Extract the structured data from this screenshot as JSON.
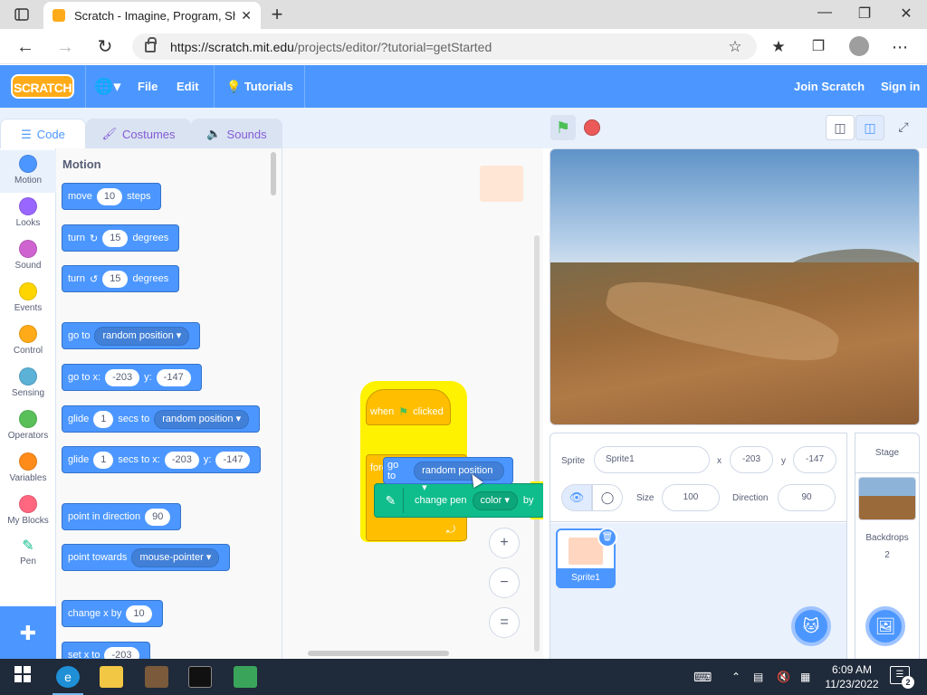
{
  "browser": {
    "tab_title": "Scratch - Imagine, Program, Share",
    "url_host": "https://scratch.mit.edu",
    "url_path": "/projects/editor/?tutorial=getStarted",
    "new_tab": "+",
    "close": "✕",
    "minimize": "—",
    "maximize": "❐"
  },
  "menu": {
    "logo": "SCRATCH",
    "file": "File",
    "edit": "Edit",
    "tutorials": "Tutorials",
    "join": "Join Scratch",
    "signin": "Sign in"
  },
  "editor_tabs": [
    "Code",
    "Costumes",
    "Sounds"
  ],
  "categories": [
    {
      "label": "Motion",
      "color": "#4c97ff"
    },
    {
      "label": "Looks",
      "color": "#9966ff"
    },
    {
      "label": "Sound",
      "color": "#cf63cf"
    },
    {
      "label": "Events",
      "color": "#ffd500"
    },
    {
      "label": "Control",
      "color": "#ffab19"
    },
    {
      "label": "Sensing",
      "color": "#5cb1d6"
    },
    {
      "label": "Operators",
      "color": "#59c059"
    },
    {
      "label": "Variables",
      "color": "#ff8c1a"
    },
    {
      "label": "My Blocks",
      "color": "#ff6680"
    },
    {
      "label": "Pen",
      "color": "#0fbd8c"
    }
  ],
  "palette": {
    "title": "Motion",
    "move": {
      "a": "move",
      "v": "10",
      "b": "steps"
    },
    "turn_cw": {
      "a": "turn",
      "v": "15",
      "b": "degrees"
    },
    "turn_ccw": {
      "a": "turn",
      "v": "15",
      "b": "degrees"
    },
    "goto": {
      "a": "go to",
      "dd": "random position"
    },
    "goto_xy": {
      "a": "go to x:",
      "x": "-203",
      "b": "y:",
      "y": "-147"
    },
    "glide": {
      "a": "glide",
      "v": "1",
      "b": "secs to",
      "dd": "random position"
    },
    "glide_xy": {
      "a": "glide",
      "v": "1",
      "b": "secs to x:",
      "x": "-203",
      "c": "y:",
      "y": "-147"
    },
    "point_dir": {
      "a": "point in direction",
      "v": "90"
    },
    "point_towards": {
      "a": "point towards",
      "dd": "mouse-pointer"
    },
    "change_x": {
      "a": "change x by",
      "v": "10"
    },
    "set_x": {
      "a": "set x to",
      "v": "-203"
    }
  },
  "script": {
    "hat": {
      "a": "when",
      "b": "clicked"
    },
    "forever": "forever",
    "goto_drag": {
      "a": "go to",
      "dd": "random position"
    },
    "pen": {
      "a": "change pen",
      "dd": "color",
      "b": "by"
    },
    "zoom_in": "+",
    "zoom_out": "−",
    "zoom_reset": "="
  },
  "sprite_info": {
    "sprite_label": "Sprite",
    "sprite_name": "Sprite1",
    "x_label": "x",
    "x": "-203",
    "y_label": "y",
    "y": "-147",
    "size_label": "Size",
    "size": "100",
    "direction_label": "Direction",
    "direction": "90",
    "sprite_tile": "Sprite1"
  },
  "stage_pane": {
    "title": "Stage",
    "backdrops_label": "Backdrops",
    "backdrops_count": "2"
  },
  "taskbar": {
    "time": "6:09 AM",
    "date": "11/23/2022",
    "notifications": "2"
  }
}
